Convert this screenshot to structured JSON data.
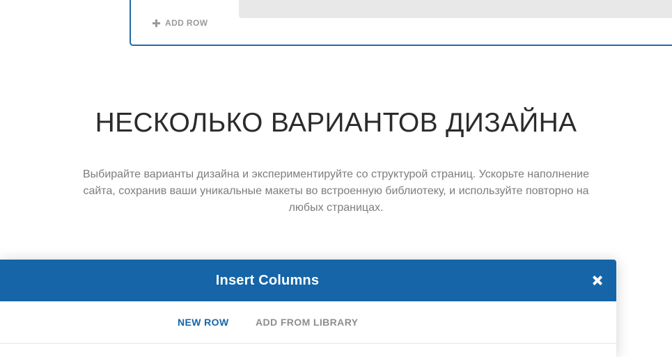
{
  "builder": {
    "add_row_label": "ADD ROW",
    "frame_color": "#1e6aa8",
    "add_row_icon": "plus-icon"
  },
  "section": {
    "title": "НЕСКОЛЬКО ВАРИАНТОВ ДИЗАЙНА",
    "description": "Выбирайте варианты дизайна и экспериментируйте со структурой страниц. Ускорьте наполнение сайта, сохранив ваши уникальные макеты во встроенную библиотеку, и используйте повторно на любых страницах."
  },
  "modal": {
    "title": "Insert Columns",
    "close_icon": "close-icon",
    "header_color": "#1565a8",
    "tabs": [
      {
        "label": "NEW ROW",
        "active": true
      },
      {
        "label": "ADD FROM LIBRARY",
        "active": false
      }
    ]
  }
}
